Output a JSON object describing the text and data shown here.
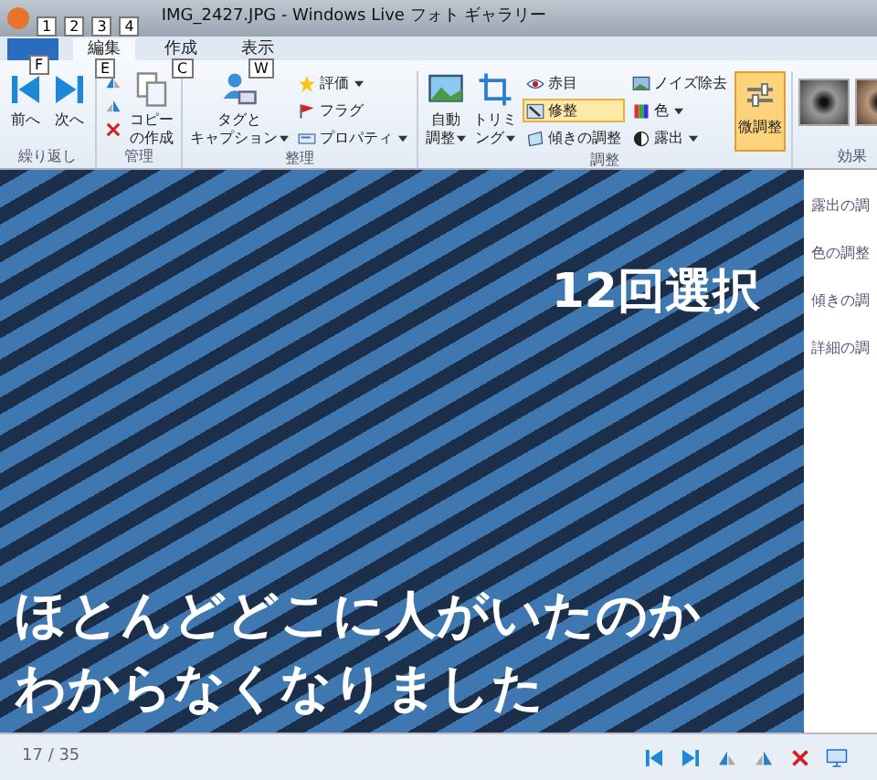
{
  "window": {
    "title": "IMG_2427.JPG - Windows Live フォト ギャラリー"
  },
  "quick_access_keytips": [
    "1",
    "2",
    "3",
    "4"
  ],
  "tabs": [
    {
      "keytip": "F",
      "kind": "app",
      "selected": false
    },
    {
      "label": "編集",
      "keytip": "E",
      "kind": "tab",
      "selected": true
    },
    {
      "label": "作成",
      "keytip": "C",
      "kind": "tab",
      "selected": false
    },
    {
      "label": "表示",
      "keytip": "W",
      "kind": "tab",
      "selected": false
    }
  ],
  "groups": [
    {
      "label": "繰り返し",
      "items": [
        {
          "kind": "big",
          "lines": [
            "前へ"
          ],
          "dropdown": false
        },
        {
          "kind": "big",
          "lines": [
            "次へ"
          ],
          "dropdown": false
        }
      ]
    },
    {
      "label": "管理",
      "items": [
        {
          "kind": "icons"
        },
        {
          "kind": "big",
          "lines": [
            "コピー",
            "の作成"
          ],
          "dropdown": false
        }
      ]
    },
    {
      "label": "整理",
      "items": [
        {
          "kind": "big",
          "lines": [
            "タグと",
            "キャプション"
          ],
          "dropdown": true
        },
        {
          "kind": "col",
          "rows": [
            {
              "label": "評価",
              "dropdown": true
            },
            {
              "label": "フラグ",
              "dropdown": false
            },
            {
              "label": "プロパティ",
              "dropdown": true
            }
          ]
        }
      ]
    },
    {
      "label": "調整",
      "items": [
        {
          "kind": "big",
          "lines": [
            "自動",
            "調整"
          ],
          "dropdown": true
        },
        {
          "kind": "big",
          "lines": [
            "トリミ",
            "ング"
          ],
          "dropdown": true
        },
        {
          "kind": "col",
          "rows": [
            {
              "label": "赤目",
              "dropdown": false,
              "selected": false
            },
            {
              "label": "修整",
              "dropdown": false,
              "selected": true
            },
            {
              "label": "傾きの調整",
              "dropdown": false,
              "selected": false
            }
          ]
        },
        {
          "kind": "col",
          "rows": [
            {
              "label": "ノイズ除去",
              "dropdown": false,
              "selected": false
            },
            {
              "label": "色",
              "dropdown": true,
              "selected": false
            },
            {
              "label": "露出",
              "dropdown": true,
              "selected": false
            }
          ]
        },
        {
          "kind": "toggle",
          "label": "微調整",
          "selected": true
        }
      ]
    },
    {
      "label": "効果",
      "items": [
        {
          "kind": "effects"
        }
      ]
    }
  ],
  "side_panel": {
    "items": [
      "露出の調",
      "色の調整",
      "傾きの調",
      "詳細の調"
    ]
  },
  "captions": [
    "12回選択",
    "ほとんどどこに人がいたのか",
    "わからなくなりました"
  ],
  "status_bar": {
    "counter": "17 / 35"
  }
}
